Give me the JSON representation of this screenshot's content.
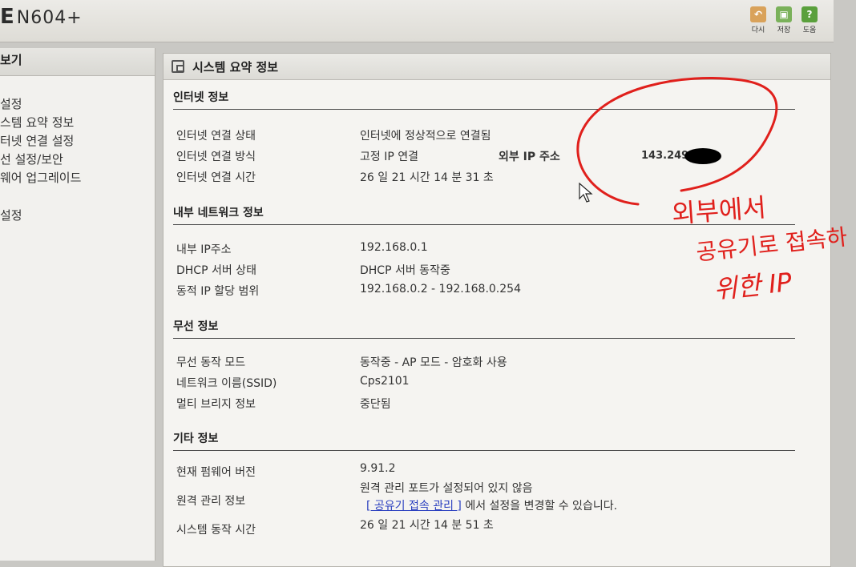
{
  "header": {
    "brand_prefix": "E",
    "brand_model": "N604+",
    "tools": [
      {
        "icon": "undo-icon",
        "glyph": "↶",
        "label": "다시"
      },
      {
        "icon": "save-icon",
        "glyph": "▣",
        "label": "저장"
      },
      {
        "icon": "help-icon",
        "glyph": "?",
        "label": "도움"
      }
    ]
  },
  "sidebar": {
    "title": "보기",
    "items": [
      "설정",
      "스템 요약 정보",
      "터넷 연결 설정",
      "선 설정/보안",
      "웨어 업그레이드",
      "설정"
    ]
  },
  "main": {
    "title": "시스템 요약 정보",
    "internet": {
      "heading": "인터넷 정보",
      "status_label": "인터넷 연결 상태",
      "status_value": "인터넷에 정상적으로 연결됨",
      "method_label": "인터넷 연결 방식",
      "method_value": "고정 IP 연결",
      "external_ip_label": "외부 IP 주소",
      "external_ip_value": "143.249",
      "uptime_label": "인터넷 연결 시간",
      "uptime_value": "26 일 21 시간 14 분 31 초"
    },
    "lan": {
      "heading": "내부 네트워크 정보",
      "ip_label": "내부 IP주소",
      "ip_value": "192.168.0.1",
      "dhcp_label": "DHCP 서버 상태",
      "dhcp_value": "DHCP 서버 동작중",
      "range_label": "동적 IP 할당 범위",
      "range_value": "192.168.0.2 -  192.168.0.254"
    },
    "wireless": {
      "heading": "무선 정보",
      "mode_label": "무선 동작 모드",
      "mode_value": "동작중 - AP 모드 - 암호화 사용",
      "ssid_label": "네트워크 이름(SSID)",
      "ssid_value": "Cps2101",
      "bridge_label": "멀티 브리지 정보",
      "bridge_value": "중단됨"
    },
    "etc": {
      "heading": "기타 정보",
      "fw_label": "현재 펌웨어 버전",
      "fw_value": "9.91.2",
      "remote_label": "원격 관리 정보",
      "remote_value": "원격 관리 포트가 설정되어 있지 않음",
      "remote_link": "[ 공유기 접속 관리 ]",
      "remote_suffix": " 에서 설정을 변경할 수 있습니다.",
      "sys_uptime_label": "시스템 동작 시간",
      "sys_uptime_value": "26 일 21 시간 14 분 51 초"
    }
  },
  "annotation": {
    "line1": "외부에서",
    "line2": "공유기로 접속하",
    "line3": "위한 IP",
    "color": "#e0201c"
  }
}
